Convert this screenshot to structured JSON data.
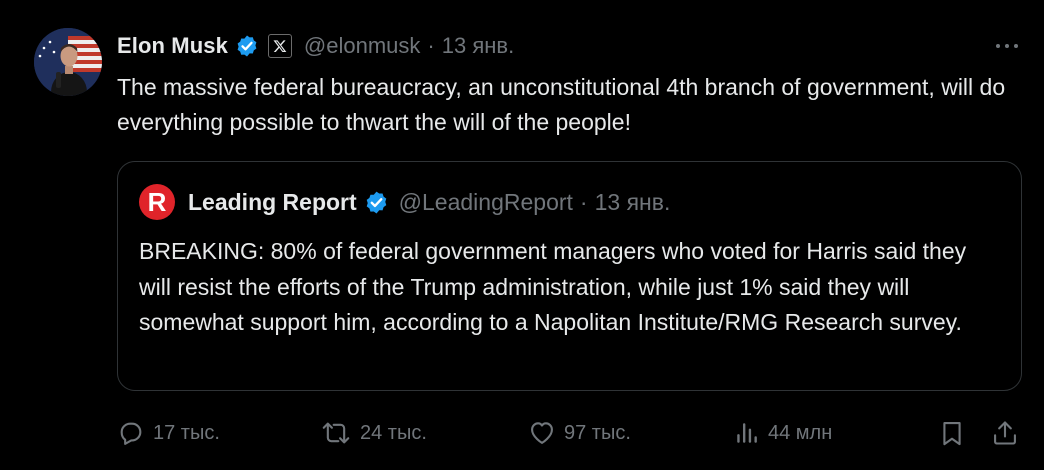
{
  "tweet": {
    "author_name": "Elon Musk",
    "author_handle": "@elonmusk",
    "separator": "·",
    "date": "13 янв.",
    "text": "The massive federal bureaucracy, an unconstitutional 4th branch of government, will do everything possible to thwart the will of the people!"
  },
  "quoted": {
    "avatar_letter": "R",
    "author_name": "Leading Report",
    "author_handle": "@LeadingReport",
    "separator": "·",
    "date": "13 янв.",
    "text": "BREAKING: 80% of federal government managers who voted for Harris said they will resist the efforts of the Trump administration, while just 1% said they will somewhat support him, according to a Napolitan Institute/RMG Research survey."
  },
  "actions": {
    "replies": "17 тыс.",
    "reposts": "24 тыс.",
    "likes": "97 тыс.",
    "views": "44 млн"
  },
  "icons": {
    "verified": "verified-badge-icon",
    "affiliate": "x-logo-icon",
    "more": "more-icon",
    "reply": "reply-icon",
    "repost": "repost-icon",
    "like": "heart-icon",
    "views": "views-icon",
    "bookmark": "bookmark-icon",
    "share": "share-icon"
  },
  "colors": {
    "background": "#000000",
    "text": "#e7e9ea",
    "muted": "#71767b",
    "verified": "#1d9bf0",
    "quote_avatar": "#e0242a",
    "border": "#2f3336"
  }
}
